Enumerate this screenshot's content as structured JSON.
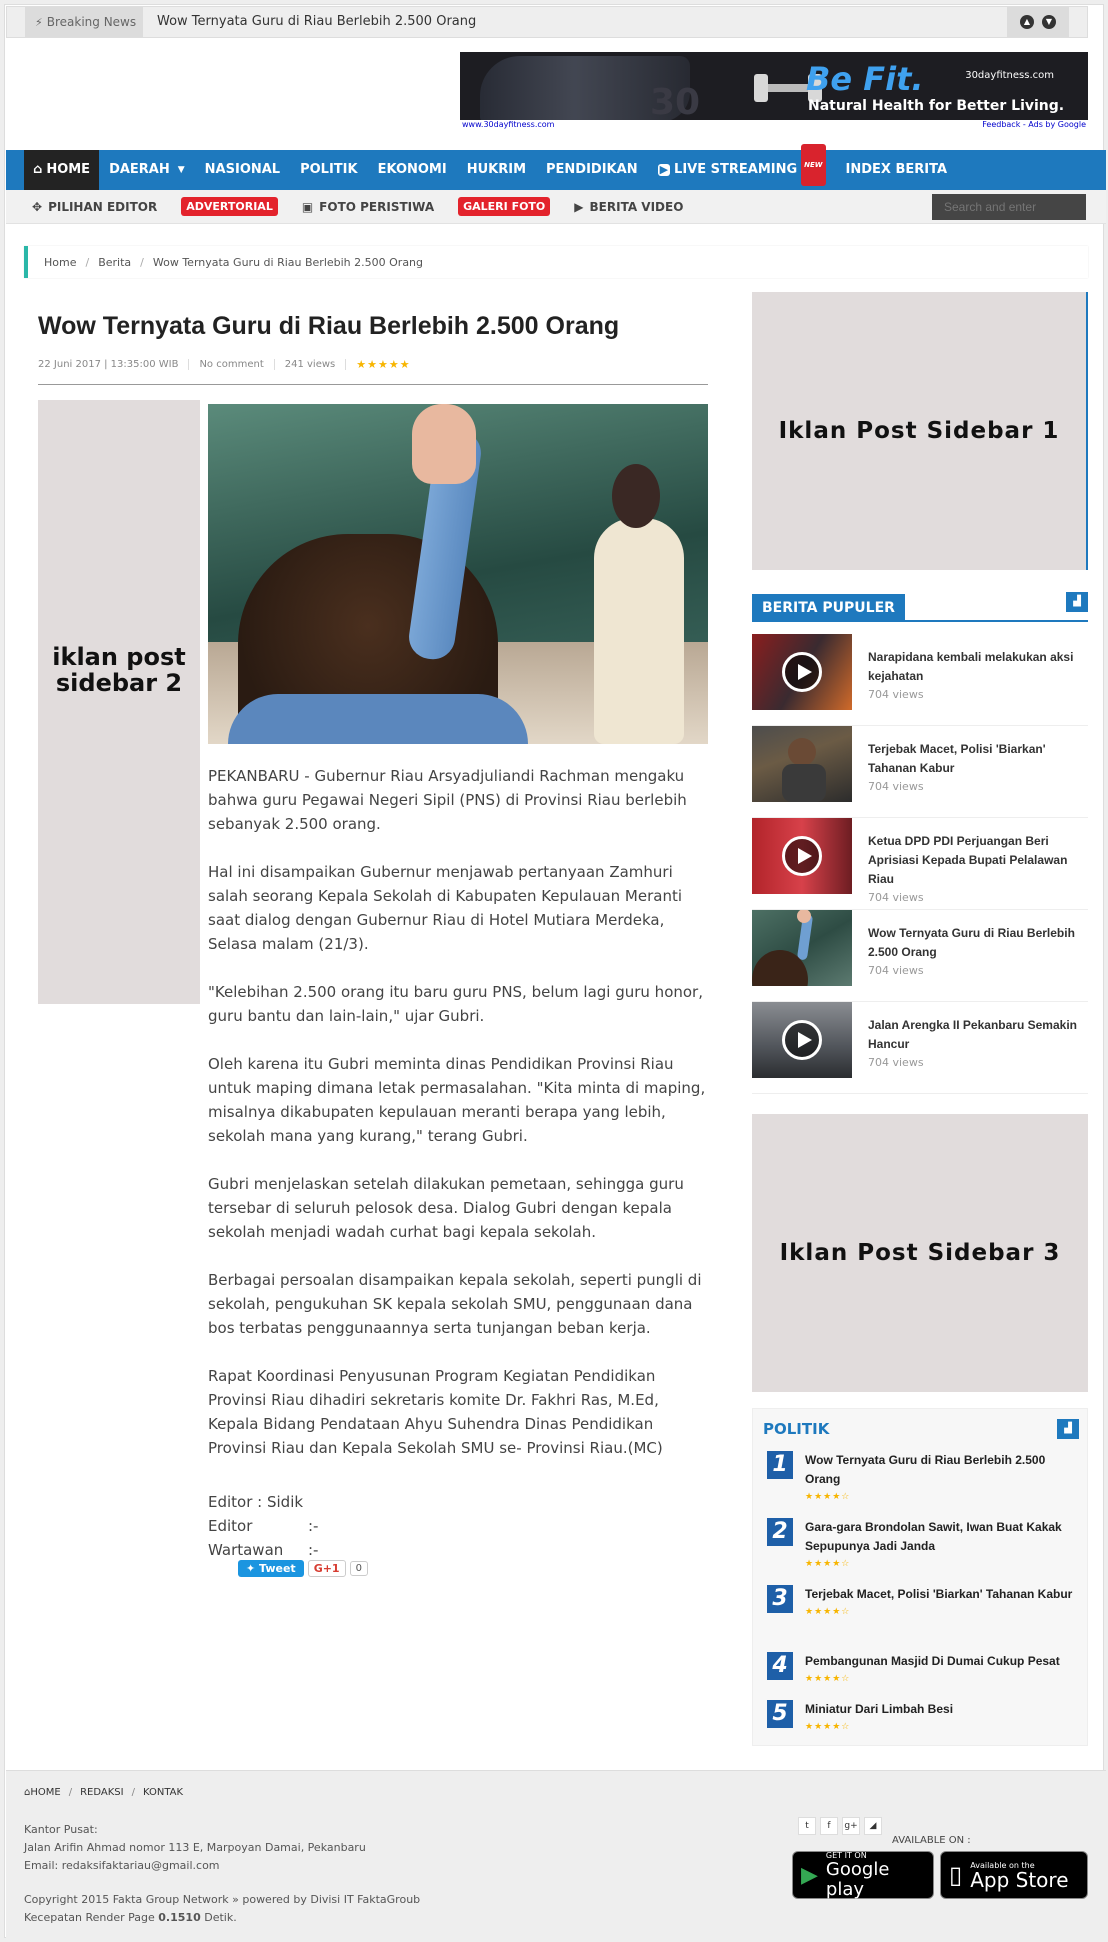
{
  "breaking": {
    "label": "Breaking News",
    "headline": "Wow Ternyata Guru di Riau Berlebih 2.500 Orang"
  },
  "banner_ad": {
    "ghost_text": "30",
    "brand": "Be Fit.",
    "site": "30dayfitness.com",
    "tagline": "Natural Health for Better Living.",
    "url": "www.30dayfitness.com",
    "feedback": "Feedback - Ads by Google"
  },
  "main_nav": {
    "items": [
      "HOME",
      "DAERAH",
      "NASIONAL",
      "POLITIK",
      "EKONOMI",
      "HUKRIM",
      "PENDIDIKAN",
      "LIVE STREAMING",
      "INDEX BERITA"
    ],
    "new_badge": "NEW"
  },
  "sub_nav": {
    "items": [
      "PILIHAN EDITOR",
      "ADVERTORIAL",
      "FOTO PERISTIWA",
      "GALERI FOTO",
      "BERITA VIDEO"
    ],
    "search_placeholder": "Search and enter"
  },
  "breadcrumb": [
    "Home",
    "Berita",
    "Wow Ternyata Guru di Riau Berlebih 2.500 Orang"
  ],
  "article": {
    "title": "Wow Ternyata Guru di Riau Berlebih 2.500 Orang",
    "date": "22 Juni 2017 | 13:35:00 WIB",
    "comments": "No comment",
    "views": "241 views",
    "rating_stars": "★★★★★",
    "side_ad": "iklan post sidebar 2",
    "paragraphs": [
      "PEKANBARU - Gubernur Riau Arsyadjuliandi Rachman mengaku bahwa guru Pegawai Negeri Sipil (PNS) di Provinsi Riau berlebih sebanyak 2.500 orang.",
      "Hal ini disampaikan Gubernur menjawab pertanyaan Zamhuri salah seorang Kepala Sekolah di Kabupaten Kepulauan Meranti saat dialog dengan Gubernur Riau di Hotel Mutiara Merdeka, Selasa malam (21/3).",
      "\"Kelebihan 2.500 orang itu baru guru PNS, belum lagi guru honor, guru bantu dan lain-lain,\" ujar Gubri.",
      "Oleh karena itu Gubri meminta dinas Pendidikan Provinsi Riau untuk maping dimana letak permasalahan. \"Kita minta di maping, misalnya dikabupaten kepulauan meranti berapa yang lebih, sekolah mana yang kurang,\" terang Gubri.",
      "Gubri menjelaskan setelah dilakukan pemetaan, sehingga guru tersebar di seluruh pelosok desa. Dialog Gubri dengan kepala sekolah menjadi wadah curhat bagi kepala sekolah.",
      "Berbagai persoalan disampaikan kepala sekolah, seperti pungli di sekolah, pengukuhan SK kepala sekolah SMU, penggunaan dana bos terbatas penggunaannya serta tunjangan beban kerja.",
      "Rapat Koordinasi Penyusunan Program Kegiatan Pendidikan Provinsi Riau dihadiri sekretaris komite Dr. Fakhri Ras, M.Ed, Kepala Bidang Pendataan Ahyu Suhendra Dinas Pendidikan Provinsi Riau dan Kepala Sekolah SMU se- Provinsi Riau.(MC)"
    ],
    "editor_line": "Editor : Sidik",
    "credits": [
      {
        "key": "Editor",
        "value": ":-"
      },
      {
        "key": "Wartawan",
        "value": ":-"
      }
    ],
    "share": {
      "tweet": "Tweet",
      "gplus": "G+1",
      "count": "0"
    }
  },
  "sidebar": {
    "ad1": "Iklan Post Sidebar 1",
    "ad3": "Iklan Post Sidebar 3",
    "popular_title": "BERITA PUPULER",
    "popular": [
      {
        "title": "Narapidana kembali melakukan aksi kejahatan",
        "views": "704 views"
      },
      {
        "title": "Terjebak Macet, Polisi 'Biarkan' Tahanan Kabur",
        "views": "704 views"
      },
      {
        "title": "Ketua DPD PDI Perjuangan Beri Aprisiasi Kepada Bupati Pelalawan Riau",
        "views": "704 views"
      },
      {
        "title": "Wow Ternyata Guru di Riau Berlebih 2.500 Orang",
        "views": "704 views"
      },
      {
        "title": "Jalan Arengka II Pekanbaru Semakin Hancur",
        "views": "704 views"
      }
    ],
    "politik_title": "POLITIK",
    "politik": [
      {
        "num": "1",
        "title": "Wow Ternyata Guru di Riau Berlebih 2.500 Orang",
        "stars": "★★★★☆"
      },
      {
        "num": "2",
        "title": "Gara-gara Brondolan Sawit, Iwan Buat Kakak Sepupunya Jadi Janda",
        "stars": "★★★★☆"
      },
      {
        "num": "3",
        "title": "Terjebak Macet, Polisi 'Biarkan' Tahanan Kabur",
        "stars": "★★★★☆"
      },
      {
        "num": "4",
        "title": "Pembangunan Masjid Di Dumai Cukup Pesat",
        "stars": "★★★★☆"
      },
      {
        "num": "5",
        "title": "Miniatur Dari Limbah Besi",
        "stars": "★★★★☆"
      }
    ]
  },
  "footer": {
    "nav": [
      "HOME",
      "REDAKSI",
      "KONTAK"
    ],
    "office_label": "Kantor Pusat:",
    "address": "Jalan Arifin Ahmad nomor 113 E, Marpoyan Damai, Pekanbaru",
    "email": "Email: redaksifaktariau@gmail.com",
    "copyright": "Copyright 2015 Fakta Group Network » powered by Divisi IT FaktaGroub",
    "render_label": "Kecepatan Render Page",
    "render_value": "0.1510",
    "render_unit": "Detik.",
    "available": "AVAILABLE ON :",
    "google_small": "GET IT ON",
    "google_big": "Google play",
    "apple_small": "Available on the",
    "apple_big": "App Store"
  },
  "colors": {
    "nav_blue": "#1e79be",
    "accent_red": "#e3232c",
    "star_yellow": "#f7b500"
  }
}
